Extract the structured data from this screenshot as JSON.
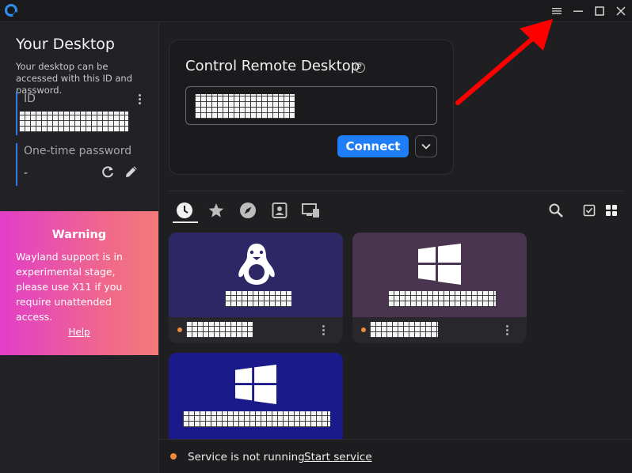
{
  "left_panel": {
    "title": "Your Desktop",
    "description": "Your desktop can be accessed with this ID and password.",
    "id_label": "ID",
    "password_label": "One-time password",
    "password_value": "-"
  },
  "warning": {
    "title": "Warning",
    "text": "Wayland support is in experimental stage, please use X11 if you require unattended access.",
    "help_link": "Help"
  },
  "control": {
    "title": "Control Remote Desktop",
    "connect_label": "Connect"
  },
  "tabs": [
    {
      "icon": "clock-icon",
      "active": true
    },
    {
      "icon": "star-icon",
      "active": false
    },
    {
      "icon": "compass-icon",
      "active": false
    },
    {
      "icon": "address-book-icon",
      "active": false
    },
    {
      "icon": "lan-devices-icon",
      "active": false
    }
  ],
  "peers": [
    {
      "os": "linux",
      "status": "offline"
    },
    {
      "os": "windows",
      "status": "offline"
    },
    {
      "os": "windows",
      "status": "unknown"
    }
  ],
  "status_bar": {
    "text": "Service is not running",
    "action": "Start service"
  },
  "colors": {
    "accent": "#1f7ef5",
    "warning_gradient_start": "#e23ec8",
    "warning_gradient_end": "#f37a7a",
    "status_offline": "#f08a3c",
    "annotation_arrow": "#ff0000",
    "linux_card": "#2d2766",
    "windows_card_1": "#4a3550",
    "windows_card_2": "#1b1a8a"
  }
}
